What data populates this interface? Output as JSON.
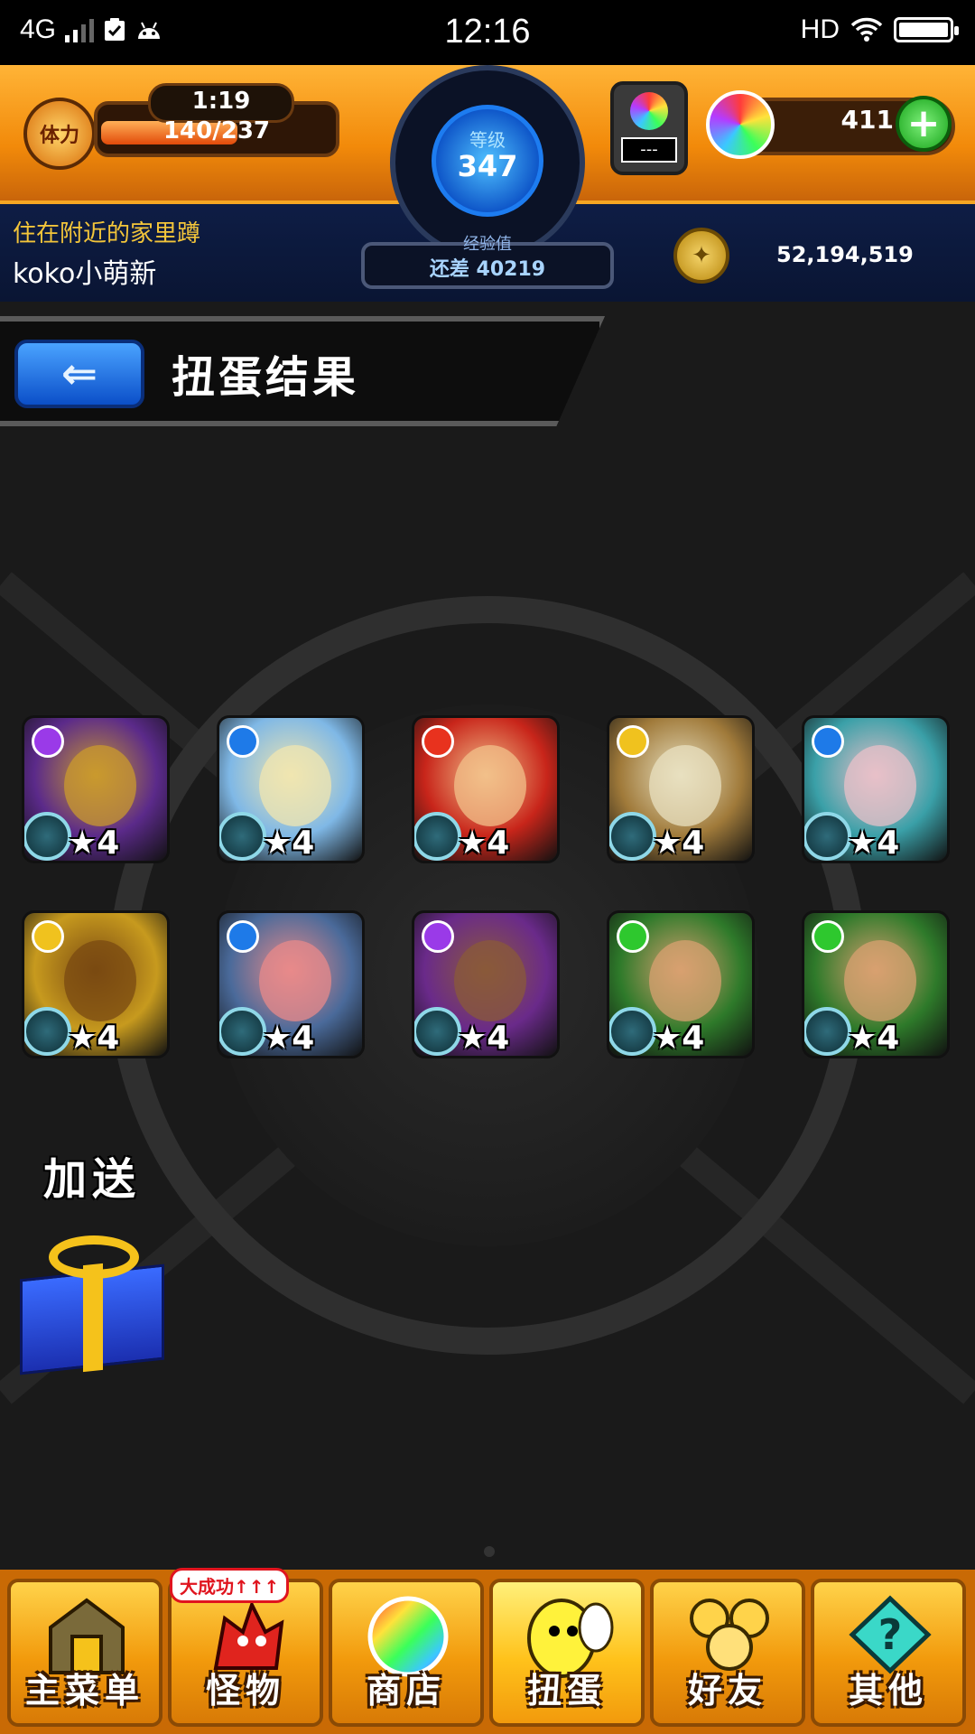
{
  "status_bar": {
    "network": "4G",
    "time": "12:16",
    "hd": "HD"
  },
  "hud": {
    "stamina_label": "体力",
    "stamina_timer": "1:19",
    "stamina_value": "140/237",
    "stamina_fraction": 0.59,
    "level_label": "等级",
    "level_value": "347",
    "exp_label": "经验值",
    "exp_remaining": "还差 40219",
    "orb_slot_text": "---",
    "orb_count": "411",
    "plus_label": "+",
    "player_title": "住在附近的家里蹲",
    "player_name": "koko小萌新",
    "coins": "52,194,519"
  },
  "page": {
    "back_label": "⇐",
    "title": "扭蛋结果"
  },
  "results": [
    {
      "rarity": "★4",
      "element": "dark",
      "bg": "#5b2a8a",
      "accent": "#c99a2e"
    },
    {
      "rarity": "★4",
      "element": "water",
      "bg": "#7fb8e6",
      "accent": "#f0e6b0"
    },
    {
      "rarity": "★4",
      "element": "fire",
      "bg": "#c8251a",
      "accent": "#f2c08a"
    },
    {
      "rarity": "★4",
      "element": "light",
      "bg": "#a07a3a",
      "accent": "#e8e0c0"
    },
    {
      "rarity": "★4",
      "element": "water",
      "bg": "#3aa0a8",
      "accent": "#e8c0c8"
    },
    {
      "rarity": "★4",
      "element": "light",
      "bg": "#c79a1e",
      "accent": "#7a4a12"
    },
    {
      "rarity": "★4",
      "element": "water",
      "bg": "#4a6a9a",
      "accent": "#e88a8a"
    },
    {
      "rarity": "★4",
      "element": "dark",
      "bg": "#6a2a8a",
      "accent": "#8a5a3a"
    },
    {
      "rarity": "★4",
      "element": "wood",
      "bg": "#2e7a2a",
      "accent": "#d8a070"
    },
    {
      "rarity": "★4",
      "element": "wood",
      "bg": "#2e7a2a",
      "accent": "#d8a070"
    }
  ],
  "element_colors": {
    "fire": "#e8321e",
    "water": "#1e7ae8",
    "wood": "#2ec82e",
    "light": "#f0c21e",
    "dark": "#9a3ae8"
  },
  "bonus": {
    "label": "加送",
    "icon": "gift-icon"
  },
  "nav": [
    {
      "label": "主菜单",
      "icon": "home-gate-icon"
    },
    {
      "label": "怪物",
      "icon": "monster-icon",
      "badge": "大成功↑↑↑"
    },
    {
      "label": "商店",
      "icon": "orb-icon"
    },
    {
      "label": "扭蛋",
      "icon": "egg-icon",
      "active": true
    },
    {
      "label": "好友",
      "icon": "friends-icon"
    },
    {
      "label": "其他",
      "icon": "question-icon"
    }
  ]
}
